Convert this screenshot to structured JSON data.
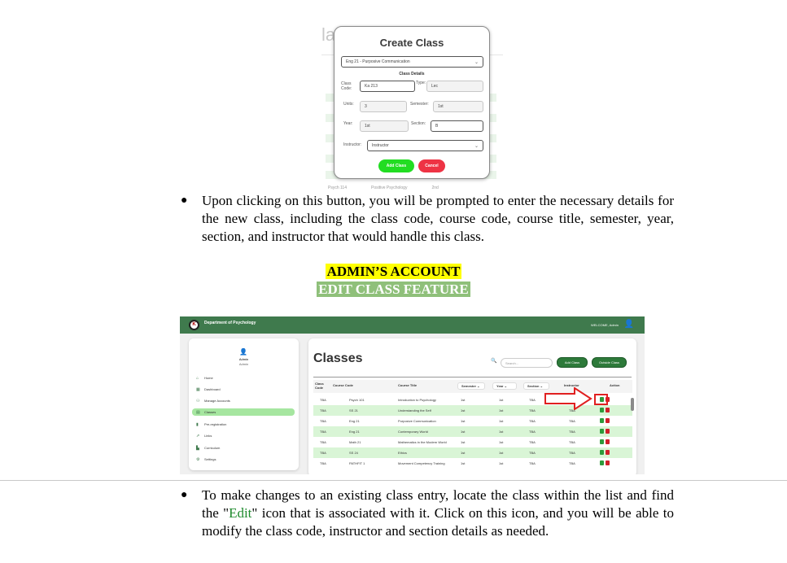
{
  "create_modal": {
    "background_title": "la",
    "title": "Create Class",
    "course_select": "Eng 21 - Purposive Communication",
    "section_header": "Class Details",
    "class_code_label": "Class Code:",
    "class_code_value": "Ka 213",
    "type_label": "Type:",
    "type_value": "Lec",
    "units_label": "Units:",
    "units_value": "3",
    "semester_label": "Semester:",
    "semester_value": "1st",
    "year_label": "Year:",
    "year_value": "1st",
    "section_label": "Section:",
    "section_value": "B",
    "instructor_label": "Instructor:",
    "instructor_value": "Instructor",
    "add_button": "Add Class",
    "cancel_button": "Cancel",
    "bg_footer": [
      "Psych 114",
      "Positive Psychology",
      "2nd"
    ],
    "colors": {
      "add": "#22dd22",
      "cancel": "#ee3344"
    }
  },
  "paragraph1": "Upon clicking on this button, you will be prompted to enter the necessary details for the new class, including the class code, course code, course title, semester, year, section, and instructor that would handle this class.",
  "heading": {
    "line1": "ADMIN’S ACCOUNT",
    "line2": "EDIT CLASS FEATURE"
  },
  "classes_page": {
    "dept_name": "Department of Psychology",
    "welcome": "WELCOME, Admin",
    "logo_text": "K",
    "sidebar": {
      "name": "Admin",
      "role": "Admin",
      "items": [
        {
          "label": "Home",
          "icon": "home-icon",
          "glyph": "⌂"
        },
        {
          "label": "Dashboard",
          "icon": "dashboard-icon",
          "glyph": "▦"
        },
        {
          "label": "Manage Accounts",
          "icon": "accounts-icon",
          "glyph": "⚇"
        },
        {
          "label": "Classes",
          "icon": "classes-icon",
          "glyph": "▤"
        },
        {
          "label": "Pre-registration",
          "icon": "document-icon",
          "glyph": "▮"
        },
        {
          "label": "Links",
          "icon": "link-icon",
          "glyph": "⇗"
        },
        {
          "label": "Curriculum",
          "icon": "curriculum-icon",
          "glyph": "▙"
        },
        {
          "label": "Settings",
          "icon": "gear-icon",
          "glyph": "⚙"
        }
      ],
      "active_index": 3
    },
    "title": "Classes",
    "search_placeholder": "Search...",
    "add_class_button": "Add Class",
    "outside_class_button": "Outside Class",
    "columns": [
      "Class Code",
      "Course Code",
      "Course Title",
      "Semester",
      "Year",
      "Section",
      "Instructor",
      "Action"
    ],
    "rows": [
      [
        "TBA",
        "Psych 101",
        "Introduction to Psychology",
        "1st",
        "1st",
        "TBA",
        "TBA"
      ],
      [
        "TBA",
        "SS 21",
        "Understanding the Self",
        "1st",
        "1st",
        "TBA",
        "TBA"
      ],
      [
        "TBA",
        "Eng 21",
        "Purposive Communication",
        "1st",
        "1st",
        "TBA",
        "TBA"
      ],
      [
        "TBA",
        "Eng 21",
        "Contemporary World",
        "1st",
        "1st",
        "TBA",
        "TBA"
      ],
      [
        "TBA",
        "Math 21",
        "Mathematics in the Modern World",
        "1st",
        "1st",
        "TBA",
        "TBA"
      ],
      [
        "TBA",
        "SS 24",
        "Ethics",
        "1st",
        "1st",
        "TBA",
        "TBA"
      ],
      [
        "TBA",
        "PATHFIT 1",
        "Movement Competency Training",
        "1st",
        "1st",
        "TBA",
        "TBA"
      ]
    ],
    "colors": {
      "topbar": "#3f7a4d",
      "row_highlight": "#d9f5d6",
      "active_nav": "#a6e6a0"
    }
  },
  "paragraph2": {
    "before": "To make changes to an existing class entry, locate the class within the list and find the \"",
    "highlight": "Edit",
    "after": "\" icon that is associated with it. Click on this icon, and you will be able to modify the class code, instructor and section details as needed."
  }
}
